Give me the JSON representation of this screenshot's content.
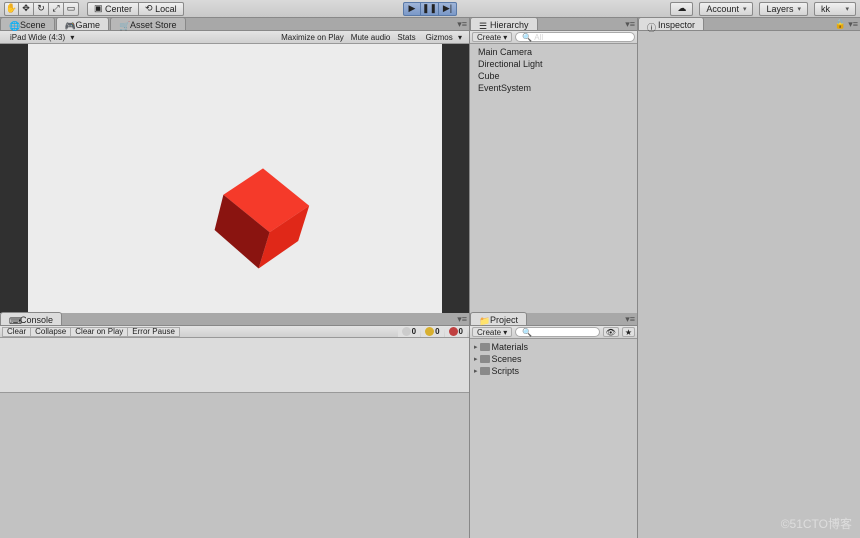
{
  "toolbar": {
    "pivot_mode": "Center",
    "space_mode": "Local",
    "cloud": "☁",
    "account": "Account",
    "layers": "Layers",
    "layout": "kk"
  },
  "scene_tabs": {
    "scene": "Scene",
    "game": "Game",
    "asset_store": "Asset Store"
  },
  "game_header": {
    "aspect": "iPad Wide (4:3)",
    "maximize": "Maximize on Play",
    "mute": "Mute audio",
    "stats": "Stats",
    "gizmos": "Gizmos"
  },
  "hierarchy": {
    "title": "Hierarchy",
    "create": "Create",
    "search_placeholder": "All",
    "items": [
      "Main Camera",
      "Directional Light",
      "Cube",
      "EventSystem"
    ]
  },
  "inspector": {
    "title": "Inspector"
  },
  "console": {
    "title": "Console",
    "clear": "Clear",
    "collapse": "Collapse",
    "clear_on_play": "Clear on Play",
    "error_pause": "Error Pause",
    "info_count": "0",
    "warn_count": "0",
    "error_count": "0"
  },
  "project": {
    "title": "Project",
    "create": "Create",
    "folders": [
      "Materials",
      "Scenes",
      "Scripts"
    ]
  },
  "watermark": "©51CTO博客"
}
